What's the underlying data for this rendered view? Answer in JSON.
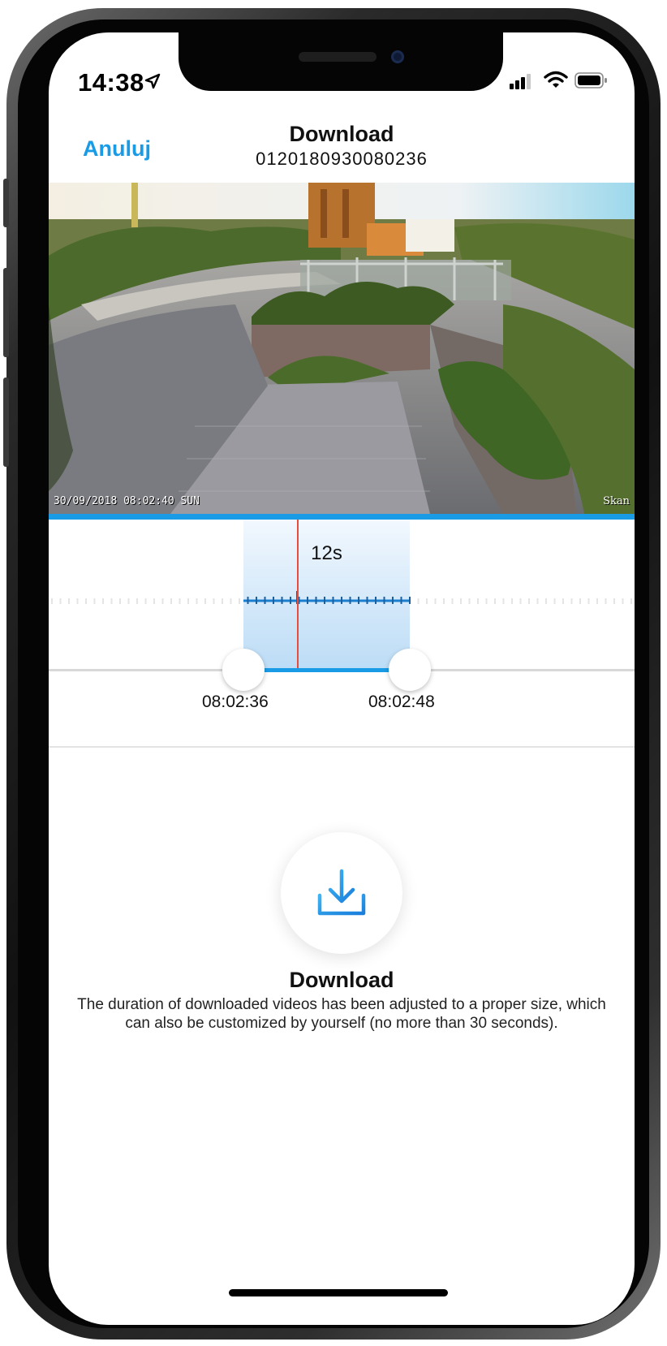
{
  "status_bar": {
    "time": "14:38"
  },
  "nav": {
    "cancel_label": "Anuluj",
    "title": "Download",
    "subtitle": "0120180930080236"
  },
  "video": {
    "osd_timestamp": "30/09/2018 08:02:40 SUN",
    "osd_camera": "Skan",
    "playback_progress": 1.0
  },
  "timeline": {
    "duration_label": "12s",
    "start_time": "08:02:36",
    "end_time": "08:02:48"
  },
  "download": {
    "title": "Download",
    "description": "The duration of downloaded videos has been adjusted to a proper size, which can also be customized by yourself (no more than 30 seconds)."
  },
  "colors": {
    "accent": "#1a9be6",
    "playhead": "#e74c3c",
    "selection": "#bcdcf6"
  }
}
